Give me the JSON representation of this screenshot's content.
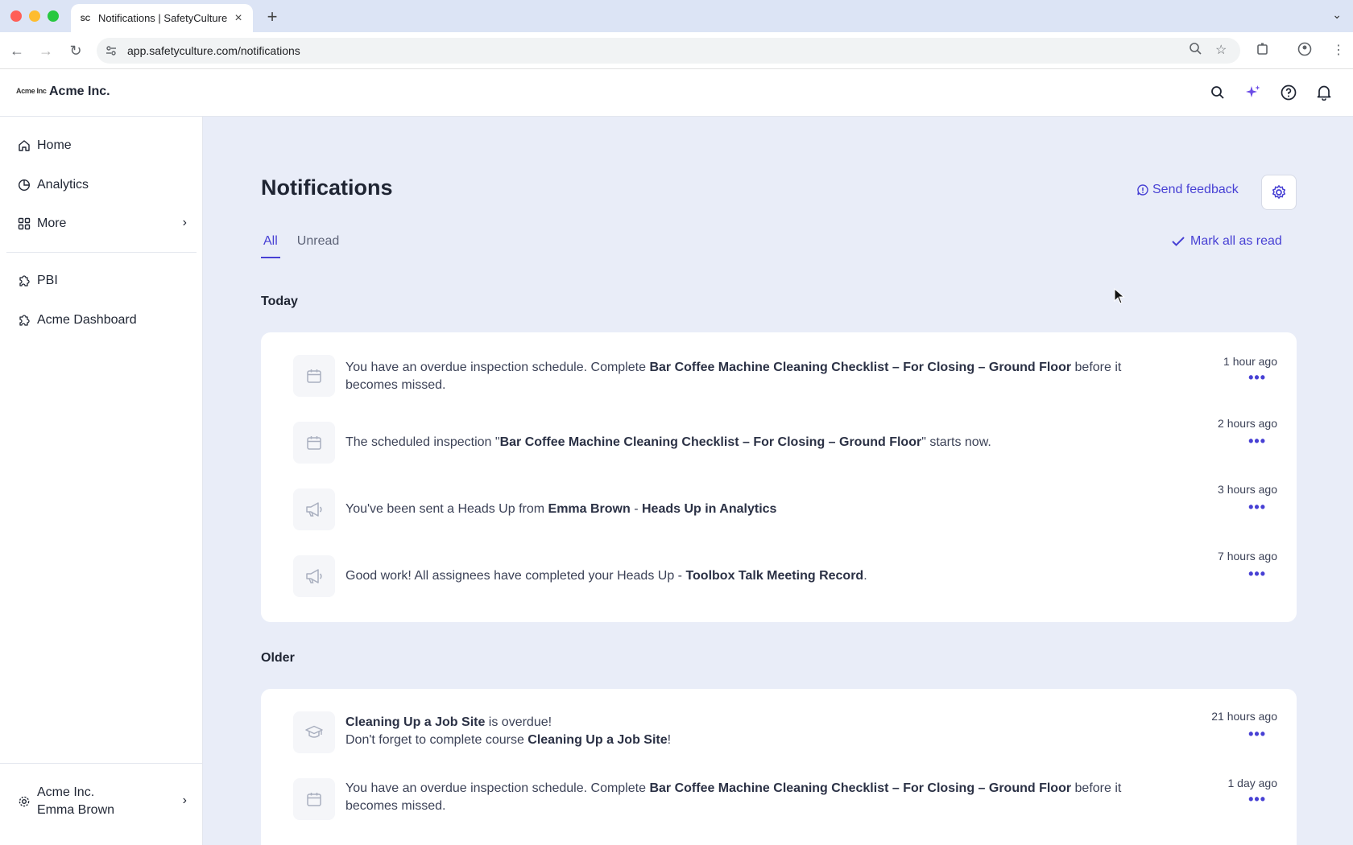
{
  "browser": {
    "tab_title": "Notifications | SafetyCulture",
    "tab_favicon": "SC",
    "url": "app.safetyculture.com/notifications"
  },
  "header": {
    "logo_text": "Acme Inc",
    "org_name": "Acme Inc."
  },
  "sidebar": {
    "items": [
      {
        "label": "Home",
        "icon": "home-icon"
      },
      {
        "label": "Analytics",
        "icon": "pie-chart-icon"
      },
      {
        "label": "More",
        "icon": "grid-icon"
      }
    ],
    "integrations": [
      {
        "label": "PBI",
        "icon": "puzzle-icon"
      },
      {
        "label": "Acme Dashboard",
        "icon": "puzzle-icon"
      }
    ],
    "account": {
      "org": "Acme Inc.",
      "user": "Emma Brown"
    }
  },
  "main": {
    "title": "Notifications",
    "feedback_label": "Send feedback",
    "tabs": [
      "All",
      "Unread"
    ],
    "active_tab": "All",
    "mark_all_label": "Mark all as read",
    "sections": [
      {
        "label": "Today",
        "items": [
          {
            "icon": "calendar-icon",
            "time": "1 hour ago",
            "parts": [
              "You have an overdue inspection schedule. Complete ",
              "Bar Coffee Machine Cleaning Checklist – For Closing – Ground Floor",
              " before it becomes missed."
            ]
          },
          {
            "icon": "calendar-icon",
            "time": "2 hours ago",
            "parts": [
              "The scheduled inspection \"",
              "Bar Coffee Machine Cleaning Checklist – For Closing – Ground Floor",
              "\" starts now."
            ]
          },
          {
            "icon": "megaphone-icon",
            "time": "3 hours ago",
            "parts": [
              "You've been sent a Heads Up from ",
              "Emma Brown",
              " - ",
              "Heads Up in Analytics",
              ""
            ]
          },
          {
            "icon": "megaphone-icon",
            "time": "7 hours ago",
            "parts": [
              "Good work! All assignees have completed your Heads Up - ",
              "Toolbox Talk Meeting Record",
              "."
            ]
          }
        ]
      },
      {
        "label": "Older",
        "items": [
          {
            "icon": "graduation-cap-icon",
            "time": "21 hours ago",
            "parts": [
              "",
              "Cleaning Up a Job Site",
              " is overdue!",
              "\nDon't forget to complete course ",
              "Cleaning Up a Job Site",
              "!"
            ]
          },
          {
            "icon": "calendar-icon",
            "time": "1 day ago",
            "parts": [
              "You have an overdue inspection schedule. Complete ",
              "Bar Coffee Machine Cleaning Checklist – For Closing – Ground Floor",
              " before it becomes missed."
            ]
          }
        ]
      }
    ]
  },
  "colors": {
    "accent": "#4740d4",
    "page_bg": "#e9edf8"
  }
}
